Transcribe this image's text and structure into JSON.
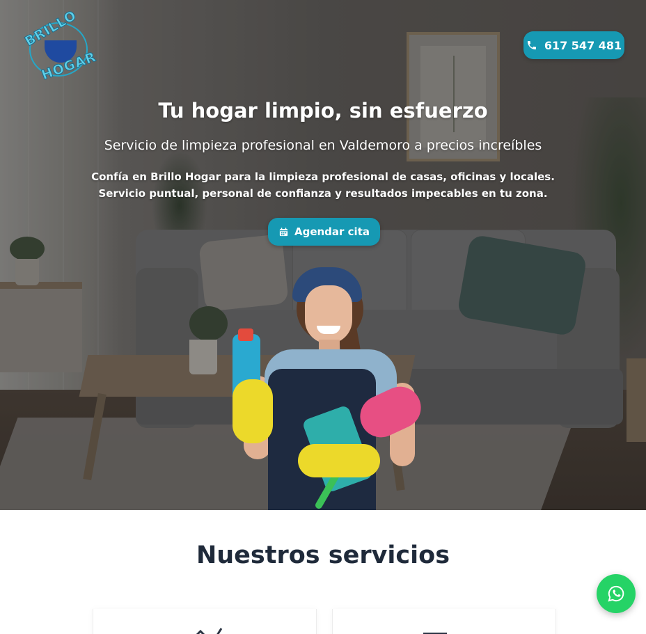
{
  "brand": {
    "logo_word_1": "BRILLO",
    "logo_word_2": "HOGAR",
    "accent_color": "#1699b3",
    "logo_text_color": "#5fd1ea"
  },
  "header": {
    "phone_label": "617 547 481",
    "phone_icon": "phone-icon"
  },
  "hero": {
    "title": "Tu hogar limpio, sin esfuerzo",
    "subtitle": "Servicio de limpieza profesional en Valdemoro a precios increíbles",
    "description_line_1": "Confía en Brillo Hogar para la limpieza profesional de casas, oficinas y locales.",
    "description_line_2": "Servicio puntual, personal de confianza y resultados impecables en tu zona.",
    "cta_label": "Agendar cita",
    "cta_icon": "calendar-icon"
  },
  "services": {
    "title": "Nuestros servicios",
    "cards": [
      {
        "icon": "house-icon"
      },
      {
        "icon": "office-icon"
      }
    ]
  },
  "floating": {
    "whatsapp_icon": "whatsapp-icon",
    "whatsapp_color": "#25d366"
  }
}
